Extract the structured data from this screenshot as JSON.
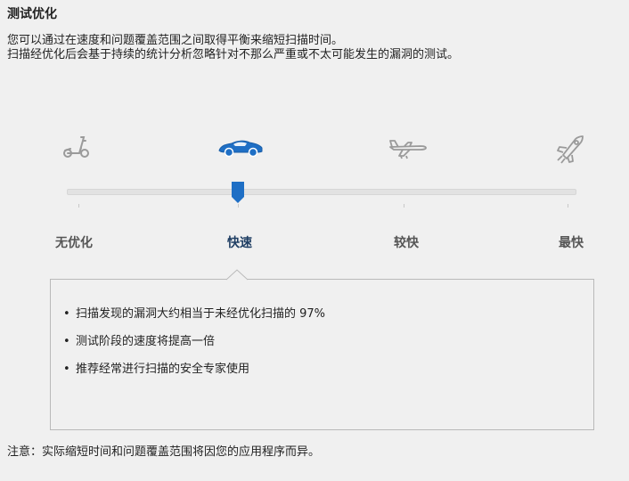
{
  "header": {
    "title": "测试优化"
  },
  "description": {
    "line1": "您可以通过在速度和问题覆盖范围之间取得平衡来缩短扫描时间。",
    "line2": "扫描经优化后会基于持续的统计分析忽略针对不那么严重或不太可能发生的漏洞的测试。"
  },
  "slider": {
    "levels": [
      {
        "label": "无优化",
        "icon": "scooter-icon"
      },
      {
        "label": "快速",
        "icon": "sports-car-icon"
      },
      {
        "label": "较快",
        "icon": "airplane-icon"
      },
      {
        "label": "最快",
        "icon": "rocket-icon"
      }
    ],
    "selected_index": 1,
    "colors": {
      "selected": "#1f6fc5",
      "inactive": "#9a9a9a"
    }
  },
  "details": {
    "bullet_glyph": "•",
    "items": [
      "扫描发现的漏洞大约相当于未经优化扫描的 97%",
      "测试阶段的速度将提高一倍",
      "推荐经常进行扫描的安全专家使用"
    ]
  },
  "footer": {
    "note": "注意：实际缩短时间和问题覆盖范围将因您的应用程序而异。"
  }
}
